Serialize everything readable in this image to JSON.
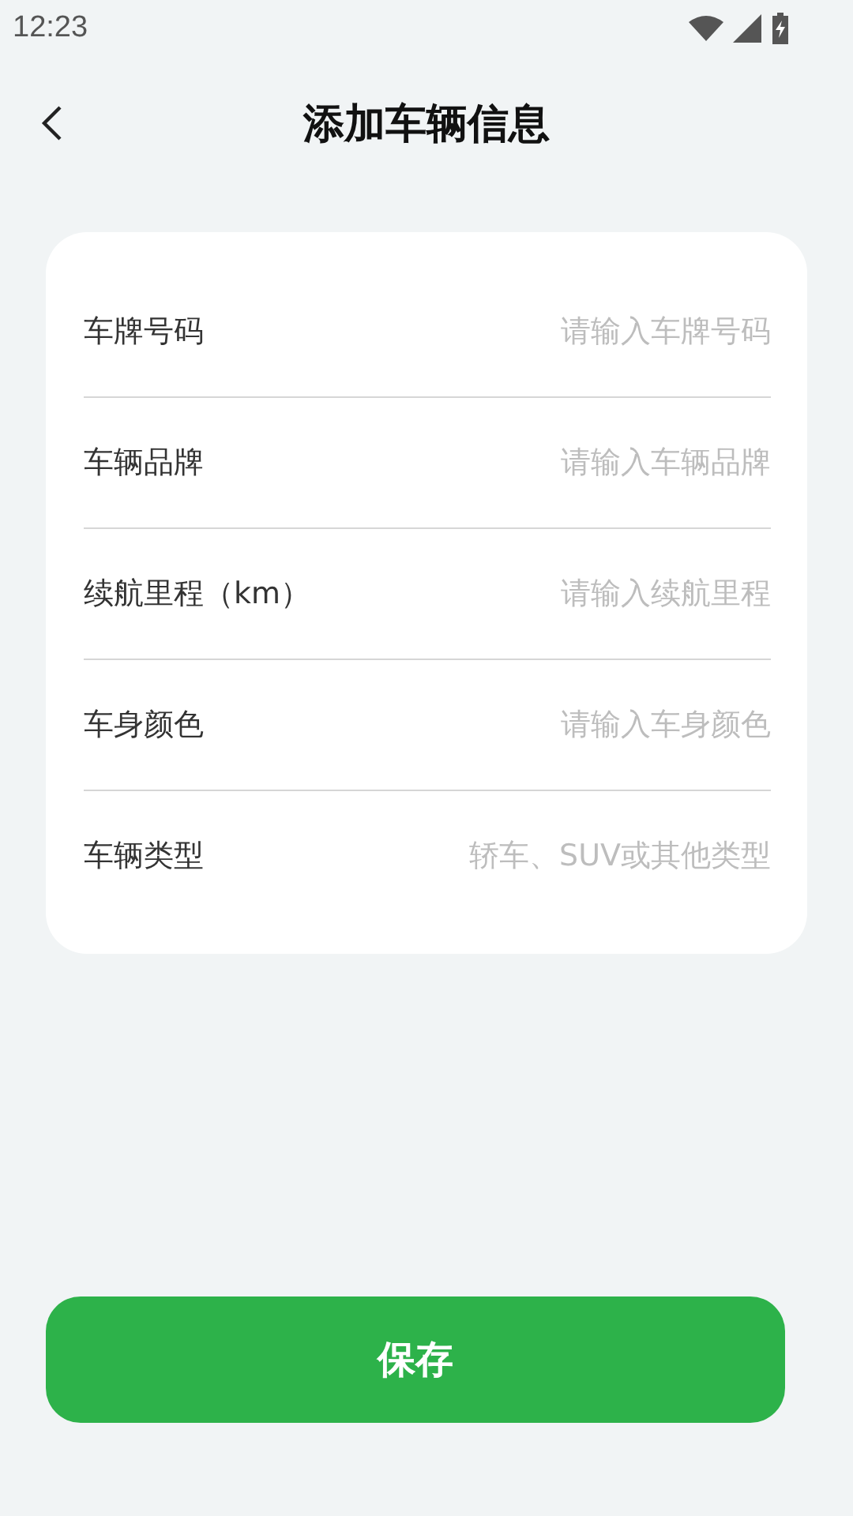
{
  "status_bar": {
    "time": "12:23"
  },
  "header": {
    "title": "添加车辆信息"
  },
  "form": {
    "fields": [
      {
        "label": "车牌号码",
        "placeholder": "请输入车牌号码"
      },
      {
        "label": "车辆品牌",
        "placeholder": "请输入车辆品牌"
      },
      {
        "label": "续航里程（km）",
        "placeholder": "请输入续航里程"
      },
      {
        "label": "车身颜色",
        "placeholder": "请输入车身颜色"
      },
      {
        "label": "车辆类型",
        "placeholder": "轿车、SUV或其他类型"
      }
    ]
  },
  "save_button": {
    "label": "保存"
  }
}
